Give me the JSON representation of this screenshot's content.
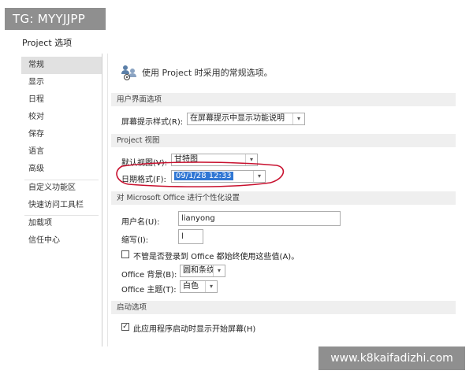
{
  "watermarks": {
    "top": "TG: MYYJJPP",
    "bottom": "www.k8kaifadizhi.com"
  },
  "dialog": {
    "title": "Project 选项"
  },
  "sidebar": {
    "items": [
      {
        "label": "常规",
        "active": true
      },
      {
        "label": "显示"
      },
      {
        "label": "日程"
      },
      {
        "label": "校对"
      },
      {
        "label": "保存"
      },
      {
        "label": "语言"
      },
      {
        "label": "高级"
      },
      {
        "label": "自定义功能区"
      },
      {
        "label": "快速访问工具栏"
      },
      {
        "label": "加载项"
      },
      {
        "label": "信任中心"
      }
    ]
  },
  "main": {
    "header_text": "使用 Project 时采用的常规选项。",
    "icon": "people-settings-icon",
    "sections": {
      "ui": {
        "title": "用户界面选项",
        "screentip_label": "屏幕提示样式(R):",
        "screentip_value": "在屏幕提示中显示功能说明"
      },
      "view": {
        "title": "Project 视图",
        "default_view_label": "默认视图(V):",
        "default_view_value": "甘特图",
        "date_format_label": "日期格式(F):",
        "date_format_value": "09/1/28 12:33"
      },
      "personalize": {
        "title": "对 Microsoft Office 进行个性化设置",
        "username_label": "用户名(U):",
        "username_value": "lianyong",
        "initials_label": "缩写(I):",
        "initials_value": "l",
        "always_use_label": "不管是否登录到 Office 都始终使用这些值(A)。",
        "always_use_checked": false,
        "background_label": "Office 背景(B):",
        "background_value": "圆和条纹",
        "theme_label": "Office 主题(T):",
        "theme_value": "白色"
      },
      "startup": {
        "title": "启动选项",
        "show_start_label": "此应用程序启动时显示开始屏幕(H)",
        "show_start_checked": true
      }
    }
  },
  "colors": {
    "selection": "#3077d4",
    "annotation": "#c8102e",
    "section_bg": "#efefef",
    "sidebar_active": "#e1e1e1"
  },
  "glyphs": {
    "dropdown": "▾",
    "check": "✓"
  }
}
